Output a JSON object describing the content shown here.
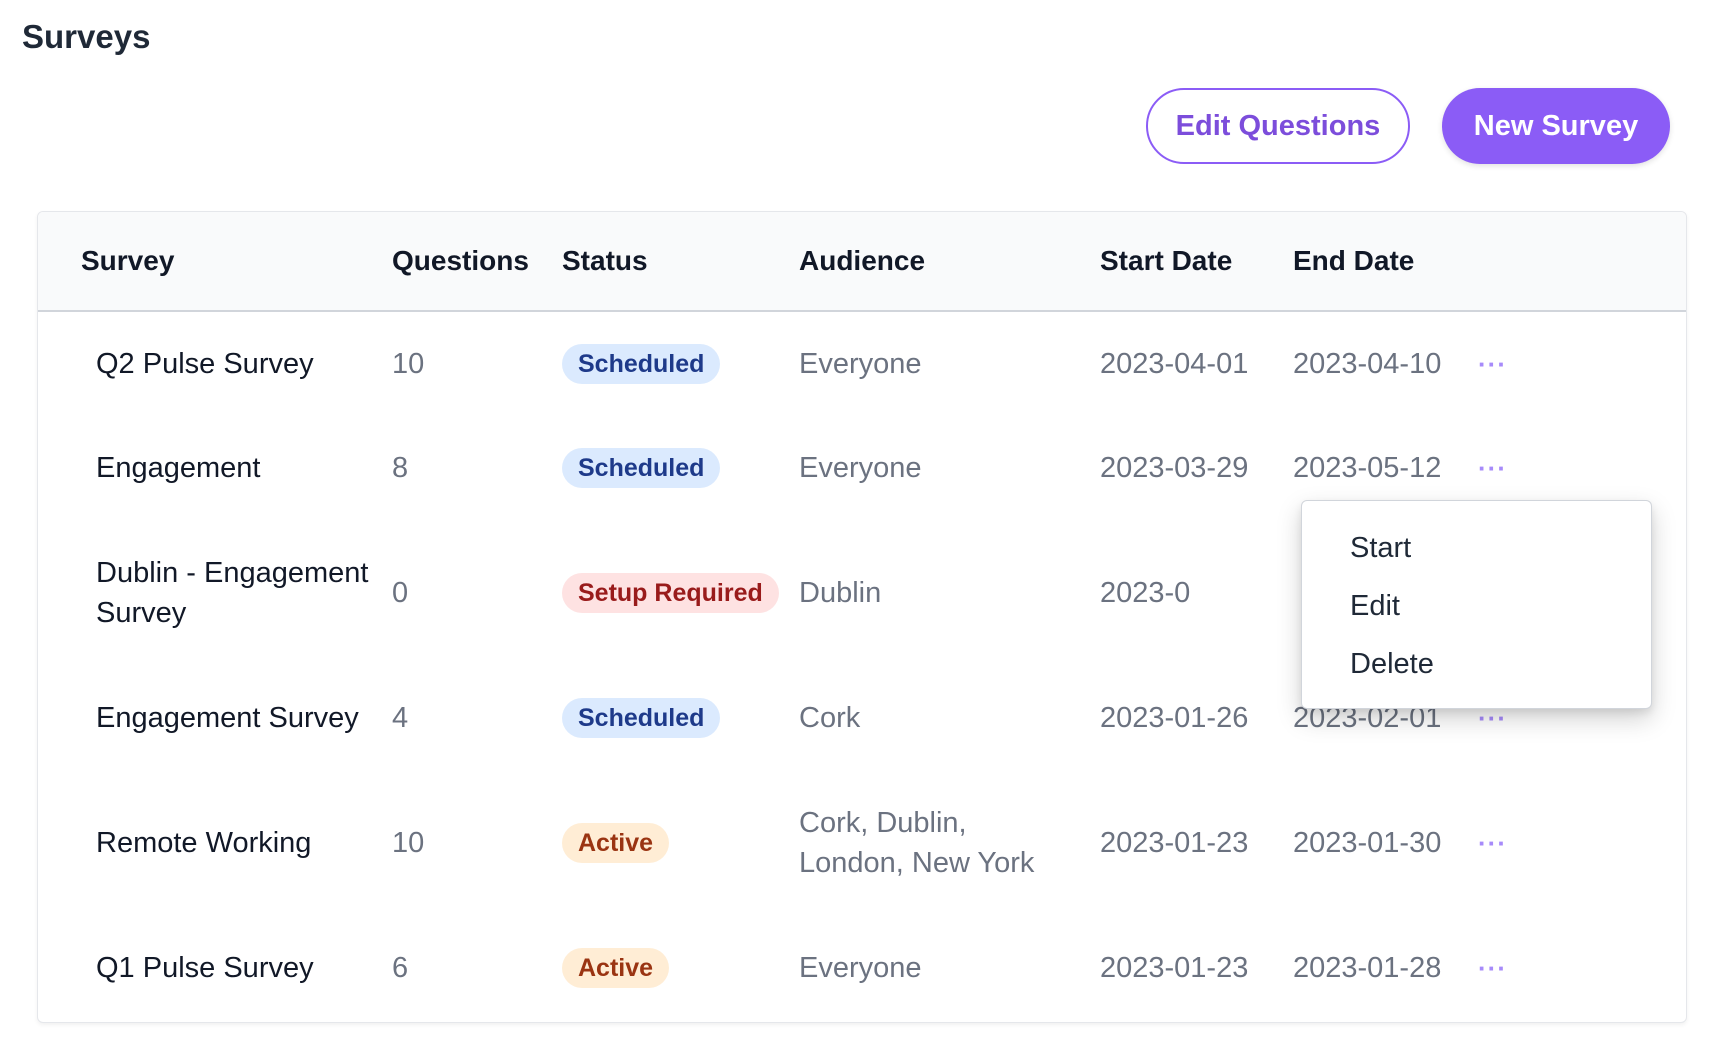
{
  "page": {
    "title": "Surveys"
  },
  "toolbar": {
    "edit_questions_label": "Edit Questions",
    "new_survey_label": "New Survey"
  },
  "table": {
    "headers": {
      "survey": "Survey",
      "questions": "Questions",
      "status": "Status",
      "audience": "Audience",
      "start_date": "Start Date",
      "end_date": "End Date"
    },
    "rows": [
      {
        "name": "Q2 Pulse Survey",
        "questions": "10",
        "status": "Scheduled",
        "audience": "Everyone",
        "start_date": "2023-04-01",
        "end_date": "2023-04-10",
        "menu": "···"
      },
      {
        "name": "Engagement",
        "questions": "8",
        "status": "Scheduled",
        "audience": "Everyone",
        "start_date": "2023-03-29",
        "end_date": "2023-05-12",
        "menu": "···"
      },
      {
        "name": "Dublin - Engagement Survey",
        "questions": "0",
        "status": "Setup Required",
        "audience": "Dublin",
        "start_date": "2023-0",
        "end_date": "",
        "menu": ""
      },
      {
        "name": "Engagement Survey",
        "questions": "4",
        "status": "Scheduled",
        "audience": "Cork",
        "start_date": "2023-01-26",
        "end_date": "2023-02-01",
        "menu": "···"
      },
      {
        "name": "Remote Working",
        "questions": "10",
        "status": "Active",
        "audience": "Cork, Dublin, London, New York",
        "start_date": "2023-01-23",
        "end_date": "2023-01-30",
        "menu": "···"
      },
      {
        "name": "Q1 Pulse Survey",
        "questions": "6",
        "status": "Active",
        "audience": "Everyone",
        "start_date": "2023-01-23",
        "end_date": "2023-01-28",
        "menu": "···"
      }
    ]
  },
  "row_menu": {
    "items": [
      "Start",
      "Edit",
      "Delete"
    ]
  },
  "colors": {
    "accent": "#8b5cf6",
    "scheduled_bg": "#dbeafe",
    "scheduled_text": "#1e3a8a",
    "setup_bg": "#fee2e2",
    "setup_text": "#991b1b",
    "active_bg": "#ffedd5",
    "active_text": "#9a3412"
  }
}
